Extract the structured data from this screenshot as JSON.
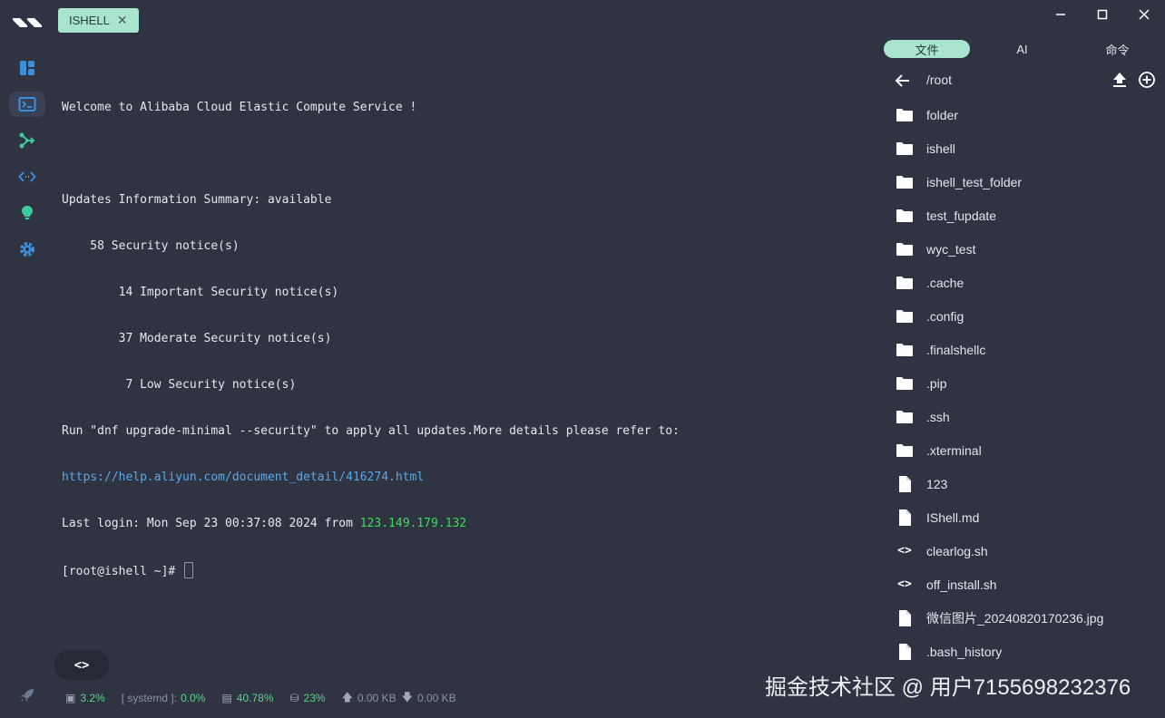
{
  "tab": {
    "title": "ISHELL",
    "close": "✕"
  },
  "window_controls": {
    "minimize": "—",
    "maximize": "☐",
    "close": "✕"
  },
  "terminal": {
    "lines": [
      {
        "text": "Welcome to Alibaba Cloud Elastic Compute Service !"
      },
      {
        "text": ""
      },
      {
        "text": "Updates Information Summary: available"
      },
      {
        "text": "    58 Security notice(s)"
      },
      {
        "text": "        14 Important Security notice(s)"
      },
      {
        "text": "        37 Moderate Security notice(s)"
      },
      {
        "text": "         7 Low Security notice(s)"
      },
      {
        "text": "Run \"dnf upgrade-minimal --security\" to apply all updates.More details please refer to:"
      },
      {
        "text": "https://help.aliyun.com/document_detail/416274.html"
      },
      {
        "prefix": "Last login: Mon Sep 23 00:37:08 2024 from ",
        "ip": "123.149.179.132"
      },
      {
        "prompt": "[root@ishell ~]# "
      }
    ]
  },
  "float_button": {
    "label": "<>"
  },
  "status": {
    "cpu": "3.2%",
    "process_label": "[ systemd ]:",
    "process_value": "0.0%",
    "memory": "40.78%",
    "disk": "23%",
    "upload": "0.00 KB",
    "download": "0.00 KB"
  },
  "panel": {
    "tabs": [
      "文件",
      "AI",
      "命令"
    ],
    "active_tab": "文件",
    "path": "/root",
    "files": [
      {
        "name": "folder",
        "icon": "folder-icon"
      },
      {
        "name": "ishell",
        "icon": "folder-icon"
      },
      {
        "name": "ishell_test_folder",
        "icon": "folder-icon"
      },
      {
        "name": "test_fupdate",
        "icon": "folder-icon"
      },
      {
        "name": "wyc_test",
        "icon": "folder-icon"
      },
      {
        "name": ".cache",
        "icon": "folder-icon"
      },
      {
        "name": ".config",
        "icon": "folder-icon"
      },
      {
        "name": ".finalshellc",
        "icon": "folder-icon"
      },
      {
        "name": ".pip",
        "icon": "folder-icon"
      },
      {
        "name": ".ssh",
        "icon": "folder-icon"
      },
      {
        "name": ".xterminal",
        "icon": "folder-icon"
      },
      {
        "name": "123",
        "icon": "file-icon"
      },
      {
        "name": "IShell.md",
        "icon": "file-icon"
      },
      {
        "name": "clearlog.sh",
        "icon": "code-icon"
      },
      {
        "name": "off_install.sh",
        "icon": "code-icon"
      },
      {
        "name": "微信图片_20240820170236.jpg",
        "icon": "file-icon"
      },
      {
        "name": ".bash_history",
        "icon": "file-icon"
      }
    ]
  },
  "watermark": "掘金技术社区 @ 用户7155698232376",
  "colors": {
    "background": "#2f3342",
    "accent": "#a9e4cf",
    "sidebar_icon": "#3b8fd9",
    "link": "#5aa9e6",
    "ip": "#3ddc55",
    "status_green": "#5fd38a"
  }
}
